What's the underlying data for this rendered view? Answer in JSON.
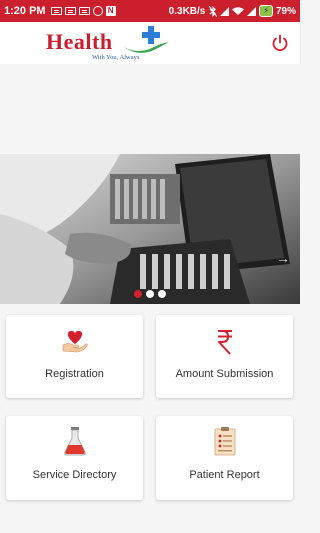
{
  "status_bar": {
    "time": "1:20 PM",
    "network_speed": "0.3KB/s",
    "battery_percent": "79%",
    "icons": [
      "message-icon",
      "message-icon",
      "message-icon",
      "whatsapp-icon",
      "n-icon",
      "bluetooth-off-icon",
      "signal-icon",
      "wifi-icon",
      "signal-icon",
      "battery-icon"
    ]
  },
  "header": {
    "logo_text": "Health",
    "logo_tagline": "With You, Always",
    "logo_colors": {
      "word": "#c8202f",
      "cross": "#2c7fd8",
      "swoosh": "#3aa84a"
    },
    "power_icon": "power-icon"
  },
  "banner": {
    "image": "lab-test-tubes-photo",
    "slides": 3,
    "active_slide": 1
  },
  "menu": [
    {
      "label": "Registration",
      "icon": "heart-hand-icon"
    },
    {
      "label": "Amount Submission",
      "icon": "rupee-icon"
    },
    {
      "label": "Service Directory",
      "icon": "flask-icon"
    },
    {
      "label": "Patient Report",
      "icon": "report-icon"
    }
  ],
  "colors": {
    "status_bar": "#cc1f2d",
    "accent": "#d3202f",
    "background": "#f5f5f5"
  }
}
